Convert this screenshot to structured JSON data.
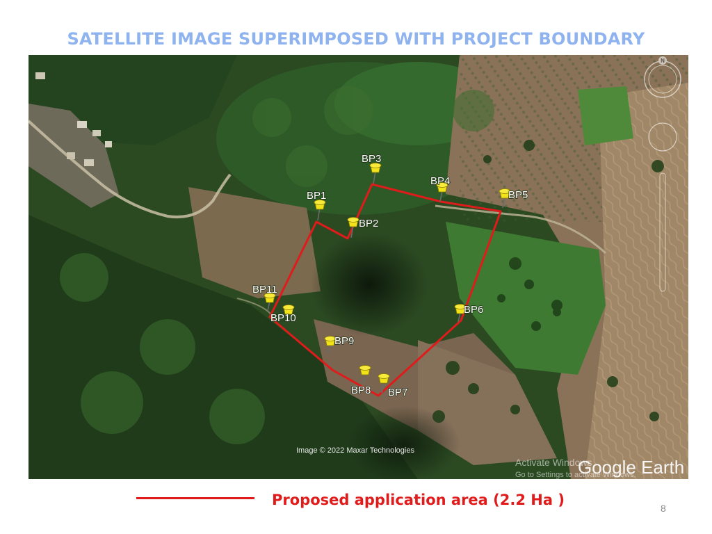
{
  "title": "SATELLITE IMAGE SUPERIMPOSED WITH PROJECT BOUNDARY",
  "map": {
    "points": [
      {
        "id": "bp1",
        "label": "BP1"
      },
      {
        "id": "bp2",
        "label": "BP2"
      },
      {
        "id": "bp3",
        "label": "BP3"
      },
      {
        "id": "bp4",
        "label": "BP4"
      },
      {
        "id": "bp5",
        "label": "BP5"
      },
      {
        "id": "bp6",
        "label": "BP6"
      },
      {
        "id": "bp7",
        "label": "BP7"
      },
      {
        "id": "bp8",
        "label": "BP8"
      },
      {
        "id": "bp9",
        "label": "BP9"
      },
      {
        "id": "bp10",
        "label": "BP10"
      },
      {
        "id": "bp11",
        "label": "BP11"
      }
    ],
    "boundary_color": "#e01b1b",
    "pin_color": "#f2e21a",
    "image_credit": "Image © 2022 Maxar Technologies",
    "watermark": "Google Earth",
    "activate_line1": "Activate Windows",
    "activate_line2": "Go to Settings to activate Windows.",
    "compass": "N"
  },
  "legend": {
    "label": "Proposed application area (2.2 Ha )",
    "color": "#e01b1b"
  },
  "page_number": "8"
}
